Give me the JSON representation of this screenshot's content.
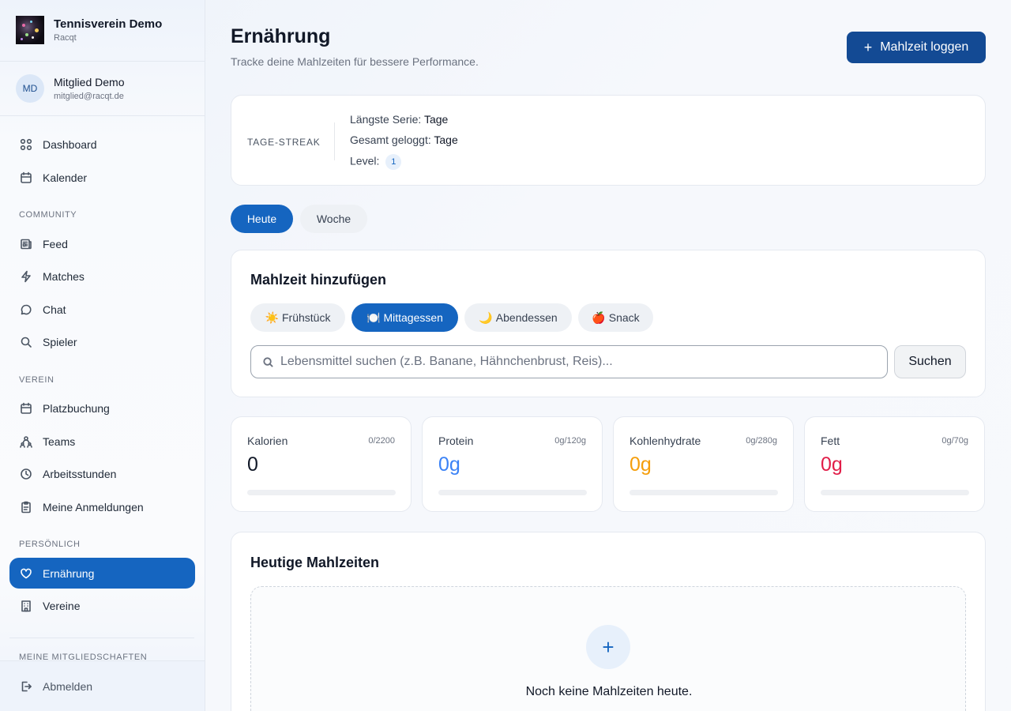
{
  "brand": {
    "title": "Tennisverein Demo",
    "subtitle": "Racqt"
  },
  "user": {
    "initials": "MD",
    "name": "Mitglied Demo",
    "email": "mitglied@racqt.de"
  },
  "sidebar": {
    "items_top": [
      {
        "label": "Dashboard",
        "icon": "dashboard-icon"
      },
      {
        "label": "Kalender",
        "icon": "calendar-icon"
      }
    ],
    "community_label": "COMMUNITY",
    "community": [
      {
        "label": "Feed",
        "icon": "newspaper-icon"
      },
      {
        "label": "Matches",
        "icon": "lightning-icon"
      },
      {
        "label": "Chat",
        "icon": "chat-icon"
      },
      {
        "label": "Spieler",
        "icon": "search-icon"
      }
    ],
    "verein_label": "VEREIN",
    "verein": [
      {
        "label": "Platzbuchung",
        "icon": "calendar-icon"
      },
      {
        "label": "Teams",
        "icon": "teams-icon"
      },
      {
        "label": "Arbeitsstunden",
        "icon": "clock-icon"
      },
      {
        "label": "Meine Anmeldungen",
        "icon": "clipboard-icon"
      }
    ],
    "personal_label": "PERSÖNLICH",
    "personal": [
      {
        "label": "Ernährung",
        "icon": "heart-icon",
        "active": true
      },
      {
        "label": "Vereine",
        "icon": "building-icon"
      }
    ],
    "memberships_label": "MEINE MITGLIEDSCHAFTEN",
    "logout": "Abmelden"
  },
  "header": {
    "title": "Ernährung",
    "subtitle": "Tracke deine Mahlzeiten für bessere Performance.",
    "log_button": "Mahlzeit loggen"
  },
  "streak": {
    "label": "TAGE-STREAK",
    "longest_label": "Längste Serie:",
    "longest_value": "Tage",
    "total_label": "Gesamt geloggt:",
    "total_value": "Tage",
    "level_label": "Level:",
    "level_value": "1"
  },
  "tabs": {
    "today": "Heute",
    "week": "Woche"
  },
  "add_meal": {
    "title": "Mahlzeit hinzufügen",
    "meal_types": [
      {
        "emoji": "☀️",
        "label": "Frühstück"
      },
      {
        "emoji": "🍽️",
        "label": "Mittagessen",
        "selected": true
      },
      {
        "emoji": "🌙",
        "label": "Abendessen"
      },
      {
        "emoji": "🍎",
        "label": "Snack"
      }
    ],
    "search_placeholder": "Lebensmittel suchen (z.B. Banane, Hähnchenbrust, Reis)...",
    "search_value": "",
    "search_button": "Suchen"
  },
  "macros": [
    {
      "name": "Kalorien",
      "value": "0",
      "goal": "0/2200",
      "progress": 0,
      "color": "#111827"
    },
    {
      "name": "Protein",
      "value": "0g",
      "goal": "0g/120g",
      "progress": 0,
      "color": "#3b82f6"
    },
    {
      "name": "Kohlenhydrate",
      "value": "0g",
      "goal": "0g/280g",
      "progress": 0,
      "color": "#f59e0b"
    },
    {
      "name": "Fett",
      "value": "0g",
      "goal": "0g/70g",
      "progress": 0,
      "color": "#e11d48"
    }
  ],
  "today_meals": {
    "title": "Heutige Mahlzeiten",
    "empty_text": "Noch keine Mahlzeiten heute."
  },
  "colors": {
    "primary": "#1565c0",
    "primary_dark": "#134a94"
  }
}
